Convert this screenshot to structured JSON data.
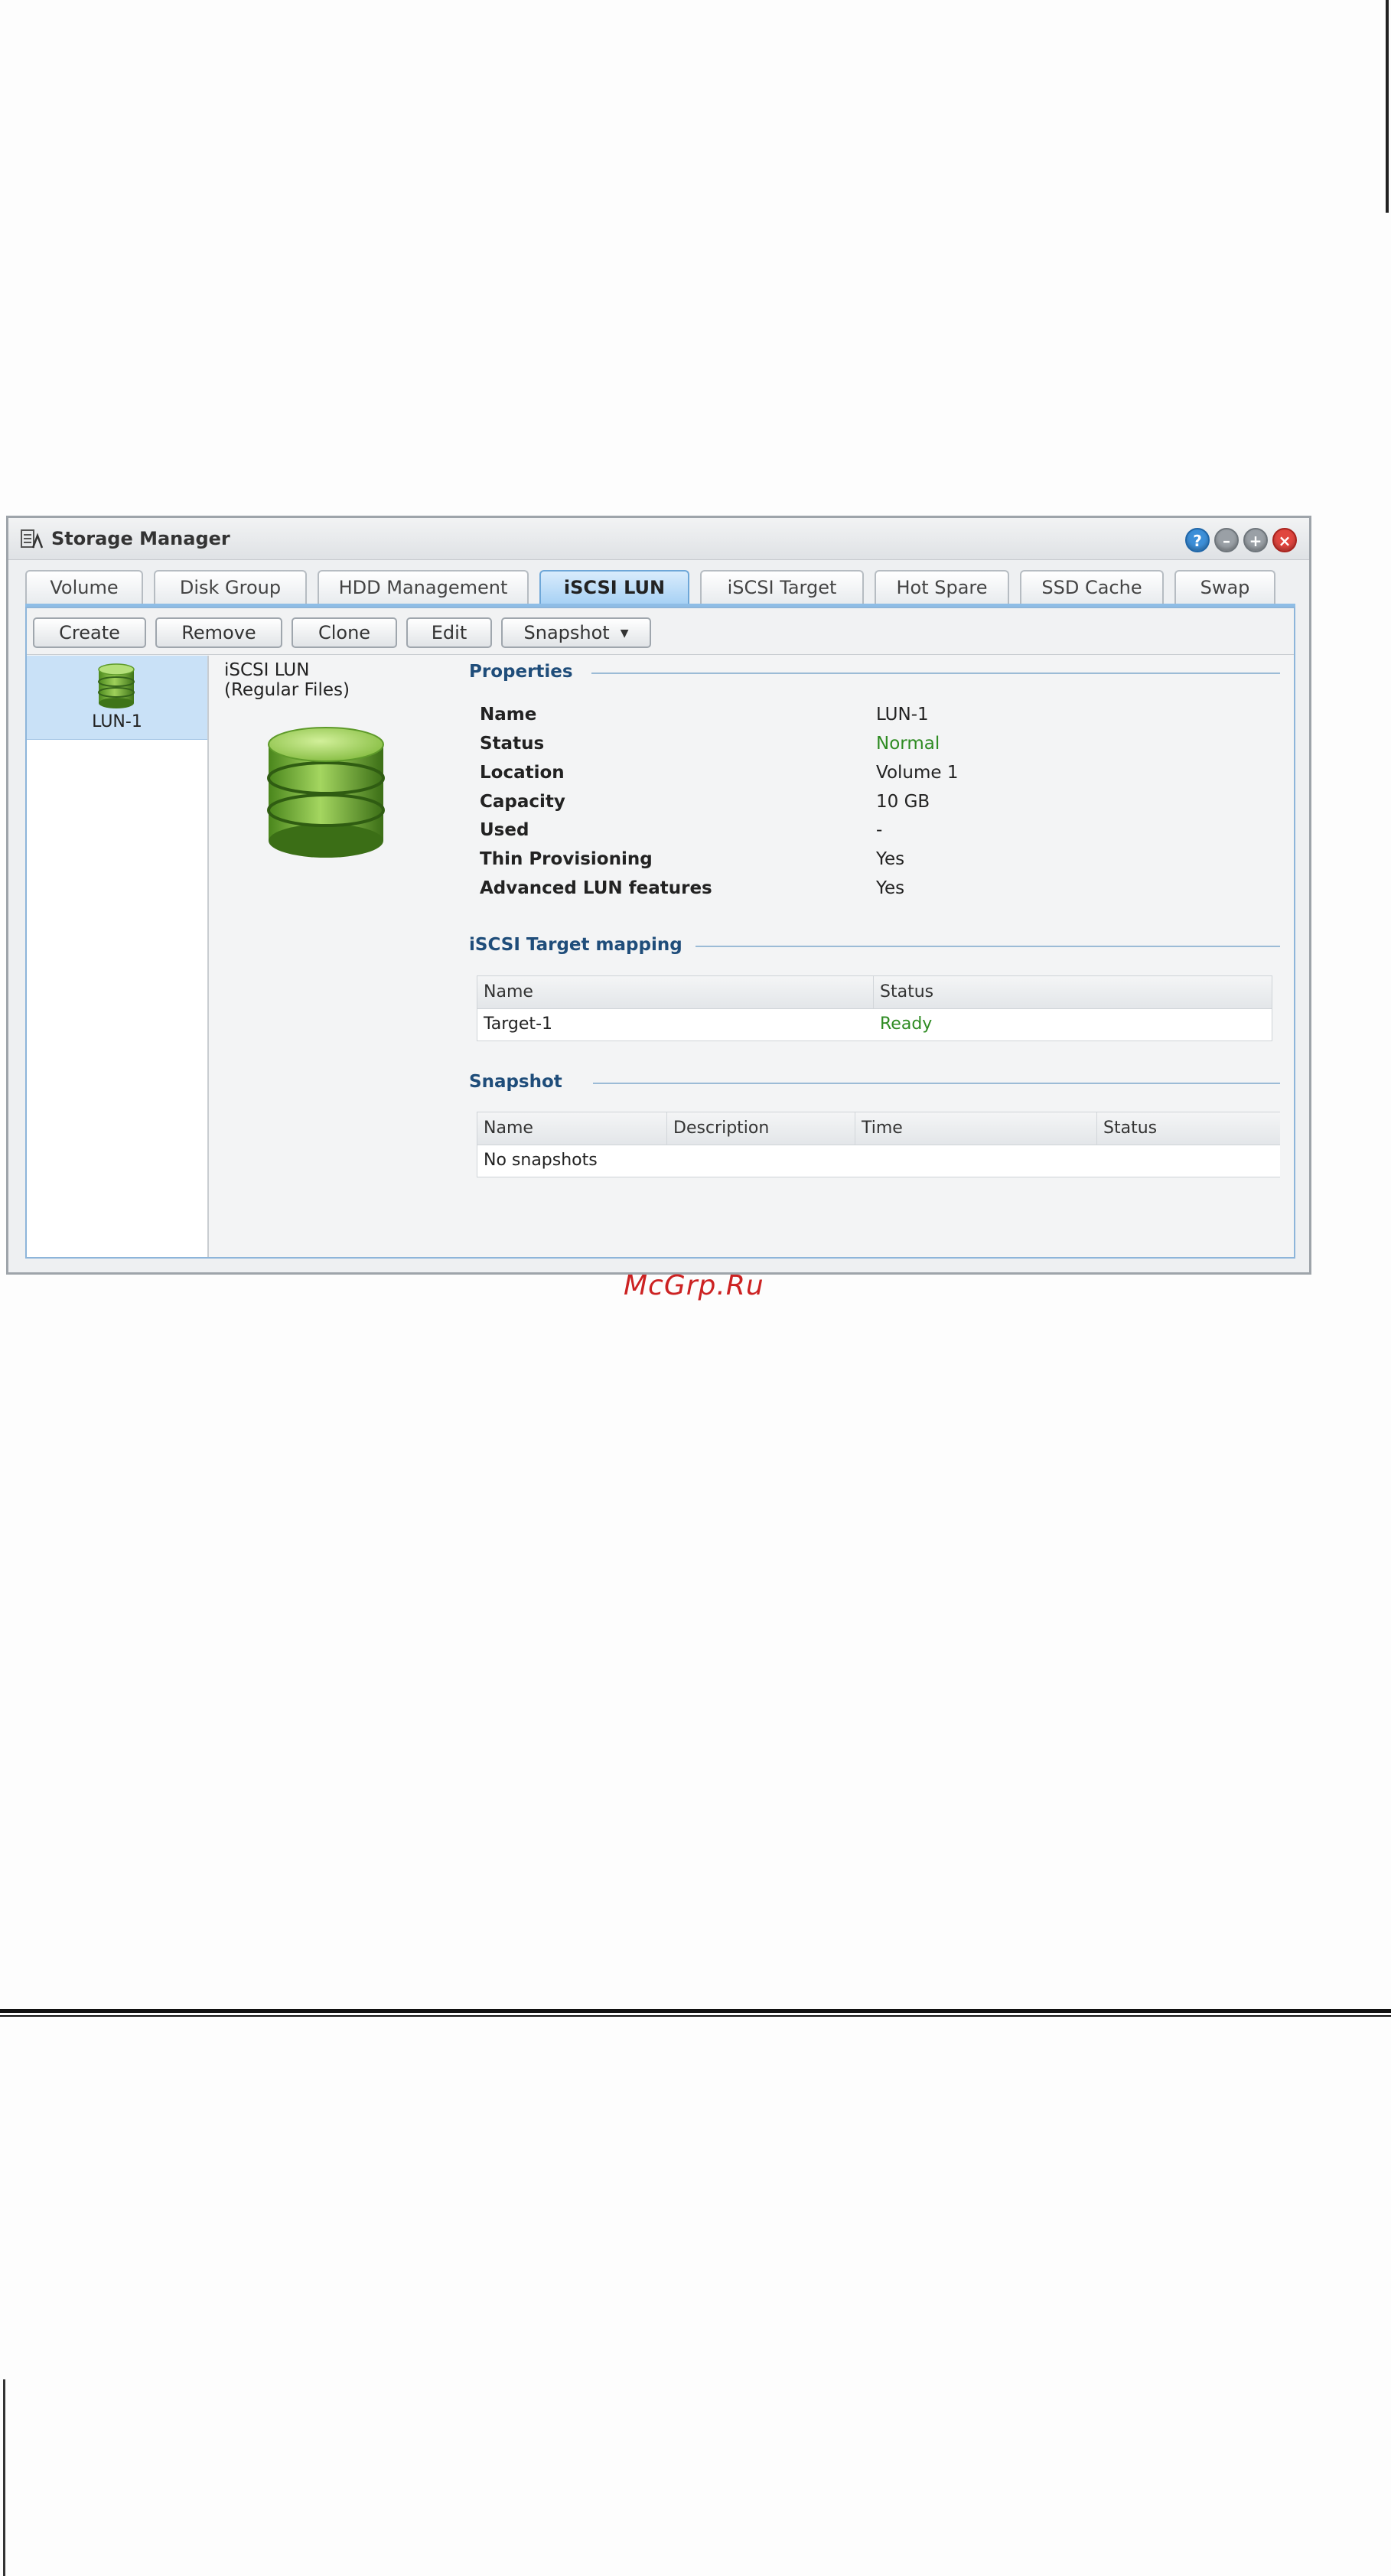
{
  "window": {
    "title": "Storage Manager",
    "controls": {
      "help": "?",
      "minimize": "–",
      "maximize": "+",
      "close": "×"
    }
  },
  "tabs": [
    {
      "label": "Volume"
    },
    {
      "label": "Disk Group"
    },
    {
      "label": "HDD Management"
    },
    {
      "label": "iSCSI LUN",
      "active": true
    },
    {
      "label": "iSCSI Target"
    },
    {
      "label": "Hot Spare"
    },
    {
      "label": "SSD Cache"
    },
    {
      "label": "Swap"
    }
  ],
  "toolbar": {
    "create": "Create",
    "remove": "Remove",
    "clone": "Clone",
    "edit": "Edit",
    "snapshot": "Snapshot"
  },
  "sidebar": {
    "items": [
      {
        "label": "LUN-1",
        "icon": "database-icon",
        "selected": true
      }
    ]
  },
  "detail": {
    "type_line1": "iSCSI LUN",
    "type_line2": "(Regular Files)",
    "properties_title": "Properties",
    "properties": [
      {
        "label": "Name",
        "value": "LUN-1"
      },
      {
        "label": "Status",
        "value": "Normal"
      },
      {
        "label": "Location",
        "value": "Volume 1"
      },
      {
        "label": "Capacity",
        "value": "10 GB"
      },
      {
        "label": "Used",
        "value": "-"
      },
      {
        "label": "Thin Provisioning",
        "value": "Yes"
      },
      {
        "label": "Advanced LUN features",
        "value": "Yes"
      }
    ],
    "mapping_title": "iSCSI Target mapping",
    "mapping": {
      "headers": [
        "Name",
        "Status"
      ],
      "rows": [
        [
          "Target-1",
          "Ready"
        ]
      ]
    },
    "snapshot_title": "Snapshot",
    "snapshot": {
      "headers": [
        "Name",
        "Description",
        "Time",
        "Status"
      ],
      "empty_text": "No snapshots"
    }
  },
  "watermark": "McGrp.Ru",
  "colors": {
    "accent_blue": "#1f4d7a",
    "status_ok": "#2e8b22",
    "tab_active": "#a5d0f4",
    "icon_green": "#6aa82e"
  }
}
